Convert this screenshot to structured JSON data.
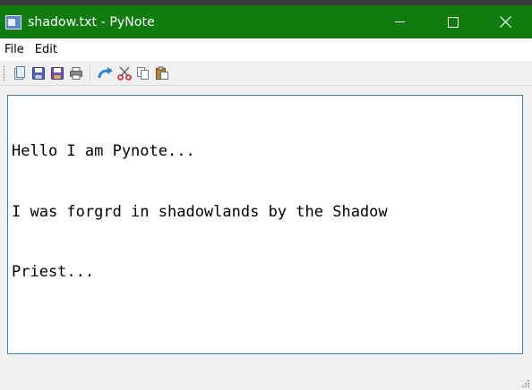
{
  "window": {
    "title": "shadow.txt - PyNote",
    "titlebar_color": "#107c10",
    "app_icon": "notepad-window-icon",
    "controls": [
      "minimize-icon",
      "maximize-icon",
      "close-icon"
    ]
  },
  "menubar": {
    "items": [
      {
        "label": "File"
      },
      {
        "label": "Edit"
      }
    ]
  },
  "toolbar": {
    "buttons": [
      {
        "icon": "new-file-icon"
      },
      {
        "icon": "save-icon"
      },
      {
        "icon": "save-as-icon"
      },
      {
        "icon": "print-icon"
      },
      {
        "icon": "redo-icon"
      },
      {
        "icon": "cut-icon"
      },
      {
        "icon": "copy-icon"
      },
      {
        "icon": "paste-icon"
      }
    ]
  },
  "editor": {
    "lines": [
      "Hello I am Pynote...",
      "I was forgrd in shadowlands by the Shadow",
      "Priest..."
    ],
    "border_color": "#3c7fb1"
  }
}
